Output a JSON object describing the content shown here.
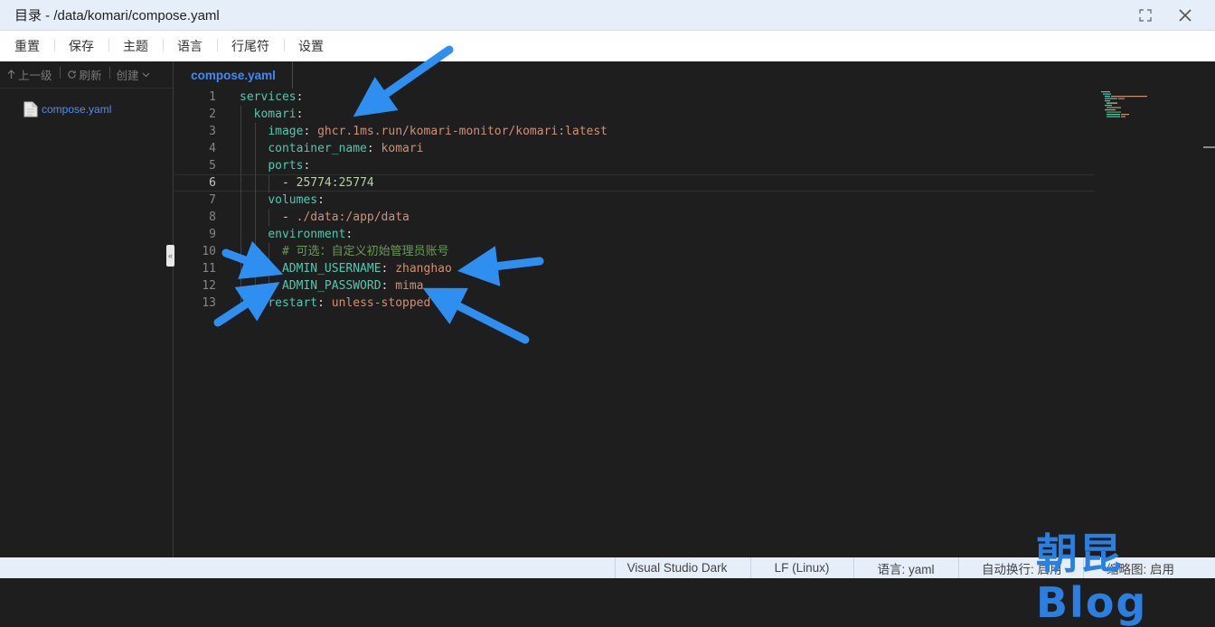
{
  "window": {
    "title": "目录 - /data/komari/compose.yaml",
    "fullscreen_icon": "fullscreen-icon",
    "close_icon": "close-icon"
  },
  "menu": {
    "items": [
      "重置",
      "保存",
      "主题",
      "语言",
      "行尾符",
      "设置"
    ]
  },
  "sidebar": {
    "up_label": "上一级",
    "refresh_label": "刷新",
    "create_label": "创建",
    "files": [
      {
        "name": "compose.yaml",
        "icon": "file-icon"
      }
    ],
    "collapse_glyph": "«"
  },
  "tabs": [
    {
      "label": "compose.yaml",
      "active": true
    }
  ],
  "editor": {
    "current_line": 6,
    "lines": [
      {
        "n": "1",
        "indent": "",
        "key": "services",
        "colon": ":",
        "value": "",
        "kind": "key"
      },
      {
        "n": "2",
        "indent": "  ",
        "key": "komari",
        "colon": ":",
        "value": "",
        "kind": "key"
      },
      {
        "n": "3",
        "indent": "    ",
        "key": "image",
        "colon": ": ",
        "value": "ghcr.1ms.run/komari-monitor/komari:latest",
        "kind": "str"
      },
      {
        "n": "4",
        "indent": "    ",
        "key": "container_name",
        "colon": ": ",
        "value": "komari",
        "kind": "str"
      },
      {
        "n": "5",
        "indent": "    ",
        "key": "ports",
        "colon": ":",
        "value": "",
        "kind": "key"
      },
      {
        "n": "6",
        "indent": "      ",
        "key": "",
        "colon": "- ",
        "value": "25774:25774",
        "kind": "num"
      },
      {
        "n": "7",
        "indent": "    ",
        "key": "volumes",
        "colon": ":",
        "value": "",
        "kind": "key"
      },
      {
        "n": "8",
        "indent": "      ",
        "key": "",
        "colon": "- ",
        "value": "./data:/app/data",
        "kind": "str"
      },
      {
        "n": "9",
        "indent": "    ",
        "key": "environment",
        "colon": ":",
        "value": "",
        "kind": "key"
      },
      {
        "n": "10",
        "indent": "      ",
        "key": "",
        "colon": "",
        "value": "# 可选：自定义初始管理员账号",
        "kind": "comment"
      },
      {
        "n": "11",
        "indent": "      ",
        "key": "ADMIN_USERNAME",
        "colon": ": ",
        "value": "zhanghao",
        "kind": "str"
      },
      {
        "n": "12",
        "indent": "      ",
        "key": "ADMIN_PASSWORD",
        "colon": ": ",
        "value": "mima",
        "kind": "str"
      },
      {
        "n": "13",
        "indent": "    ",
        "key": "restart",
        "colon": ": ",
        "value": "unless-stopped",
        "kind": "str"
      }
    ]
  },
  "status": {
    "theme": "Visual Studio Dark",
    "eol": "LF (Linux)",
    "language": "语言: yaml",
    "wrap": "自动换行: 启用",
    "minimap": "缩略图: 启用"
  },
  "watermark": "朝昆Blog",
  "colors": {
    "accent": "#3b8bff",
    "yaml_key": "#4ec9b0",
    "yaml_string": "#ce9178",
    "yaml_comment": "#6a9955",
    "annotation_arrow": "#2e8ff0"
  }
}
